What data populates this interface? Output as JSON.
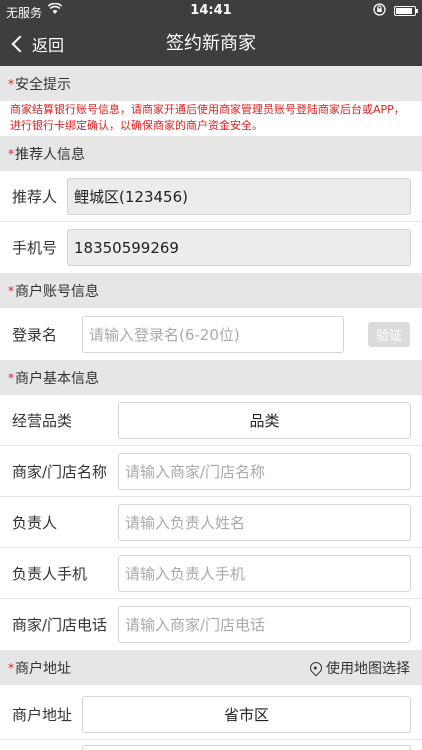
{
  "status_bar": {
    "carrier": "无服务",
    "time": "14:41",
    "battery_percent": 90,
    "icons": [
      "wifi-icon",
      "orientation-lock-icon",
      "battery-icon"
    ]
  },
  "nav": {
    "back_label": "返回",
    "title": "签约新商家"
  },
  "required_mark": "*",
  "sections": {
    "safety": "安全提示",
    "referrer": "推荐人信息",
    "account": "商户账号信息",
    "basic": "商户基本信息",
    "address": "商户地址"
  },
  "safety_notice": "商家结算银行账号信息，请商家开通后使用商家管理员账号登陆商家后台或APP，进行银行卡绑定确认，以确保商家的商户资金安全。",
  "referrer": {
    "name_label": "推荐人",
    "name_value": "鲤城区(123456)",
    "phone_label": "手机号",
    "phone_value": "18350599269"
  },
  "account": {
    "login_label": "登录名",
    "login_placeholder": "请输入登录名(6-20位)",
    "verify_label": "验证"
  },
  "basic": {
    "category_label": "经营品类",
    "category_value": "品类",
    "store_name_label": "商家/门店名称",
    "store_name_placeholder": "请输入商家/门店名称",
    "owner_label": "负责人",
    "owner_placeholder": "请输入负责人姓名",
    "owner_phone_label": "负责人手机",
    "owner_phone_placeholder": "请输入负责人手机",
    "store_phone_label": "商家/门店电话",
    "store_phone_placeholder": "请输入商家/门店电话"
  },
  "address": {
    "map_select_label": "使用地图选择",
    "region_label": "商户地址",
    "region_value": "省市区"
  }
}
